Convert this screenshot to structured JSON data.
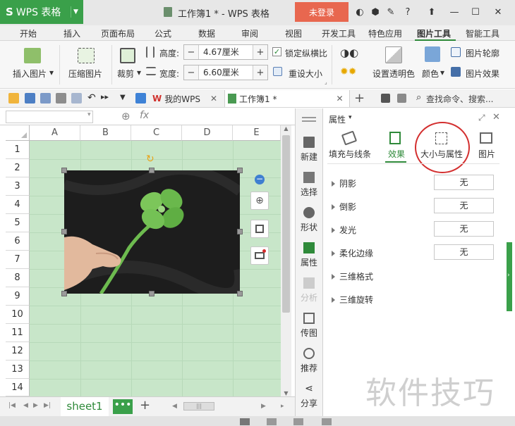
{
  "app": {
    "logo_label": "WPS 表格",
    "window_title": "工作簿1 * - WPS 表格",
    "login_label": "未登录"
  },
  "ribbon_tabs": [
    "开始",
    "插入",
    "页面布局",
    "公式",
    "数据",
    "审阅",
    "视图",
    "开发工具",
    "特色应用",
    "图片工具",
    "智能工具"
  ],
  "ribbon": {
    "insert_picture": "插入图片",
    "compress_picture": "压缩图片",
    "crop": "裁剪",
    "height_label": "高度:",
    "height_value": "4.67厘米",
    "width_label": "宽度:",
    "width_value": "6.60厘米",
    "lock_ratio": "锁定纵横比",
    "reset_size": "重设大小",
    "set_transparent": "设置透明色",
    "color": "颜色",
    "picture_outline": "图片轮廓",
    "picture_effect": "图片效果"
  },
  "quickbar": {
    "tab_mywps": "我的WPS",
    "tab_workbook": "工作簿1 *",
    "search_placeholder": "查找命令、搜索..."
  },
  "formula_bar": {
    "fx": "fx"
  },
  "sheet": {
    "columns": [
      "A",
      "B",
      "C",
      "D",
      "E"
    ],
    "rows": [
      "1",
      "2",
      "3",
      "4",
      "5",
      "6",
      "7",
      "8",
      "9",
      "10",
      "11",
      "12",
      "13",
      "14"
    ],
    "active_sheet": "sheet1"
  },
  "side_toolbar": [
    "新建",
    "选择",
    "形状",
    "属性",
    "分析",
    "传图",
    "推荐",
    "分享"
  ],
  "property_pane": {
    "title": "属性",
    "tabs": [
      "填充与线条",
      "效果",
      "大小与属性",
      "图片"
    ],
    "active_tab": "效果",
    "rows": [
      {
        "label": "阴影",
        "value": "无"
      },
      {
        "label": "倒影",
        "value": "无"
      },
      {
        "label": "发光",
        "value": "无"
      },
      {
        "label": "柔化边缘",
        "value": "无"
      },
      {
        "label": "三维格式",
        "value": ""
      },
      {
        "label": "三维旋转",
        "value": ""
      }
    ]
  },
  "watermark": "软件技巧",
  "colors": {
    "accent": "#3aa04a",
    "login": "#e8674f",
    "sheet_bg": "#c8e6c9",
    "highlight_circle": "#d32f2f"
  }
}
